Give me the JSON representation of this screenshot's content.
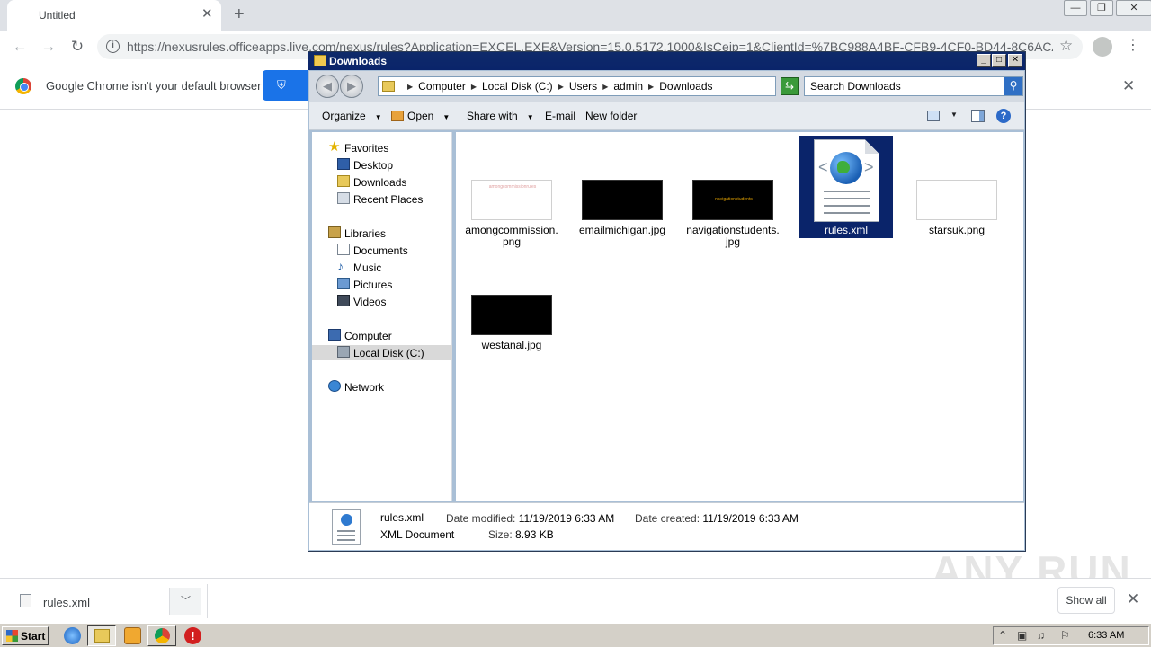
{
  "chrome": {
    "tab_title": "Untitled",
    "tab_close": "✕",
    "new_tab": "+",
    "url": "https://nexusrules.officeapps.live.com/nexus/rules?Application=EXCEL.EXE&Version=15.0.5172.1000&IsCeip=1&ClientId=%7BC988A4BF-CFB9-4CF0-BD44-8C6ACA...",
    "infobar_text": "Google Chrome isn't your default browser",
    "infobar_button_label": "S",
    "infobar_close": "✕"
  },
  "explorer": {
    "title": "Downloads",
    "breadcrumbs": [
      "Computer",
      "Local Disk (C:)",
      "Users",
      "admin",
      "Downloads"
    ],
    "search_placeholder": "Search Downloads",
    "commands": {
      "organize": "Organize",
      "open": "Open",
      "share_with": "Share with",
      "email": "E-mail",
      "new_folder": "New folder"
    },
    "nav": {
      "favorites": "Favorites",
      "desktop": "Desktop",
      "downloads": "Downloads",
      "recent_places": "Recent Places",
      "libraries": "Libraries",
      "documents": "Documents",
      "music": "Music",
      "pictures": "Pictures",
      "videos": "Videos",
      "computer": "Computer",
      "local_disk": "Local Disk (C:)",
      "network": "Network"
    },
    "files": [
      {
        "name": "amongcommission.png",
        "thumb": "white",
        "caption": "amongcommissionrules"
      },
      {
        "name": "emailmichigan.jpg",
        "thumb": "black",
        "caption": ""
      },
      {
        "name": "navigationstudents.jpg",
        "thumb": "black",
        "caption": "navigationstudents"
      },
      {
        "name": "rules.xml",
        "thumb": "xml",
        "caption": ""
      },
      {
        "name": "starsuk.png",
        "thumb": "white",
        "caption": ""
      },
      {
        "name": "westanal.jpg",
        "thumb": "black",
        "caption": ""
      }
    ],
    "details": {
      "name": "rules.xml",
      "type": "XML Document",
      "modified_label": "Date modified:",
      "modified_value": "11/19/2019 6:33 AM",
      "created_label": "Date created:",
      "created_value": "11/19/2019 6:33 AM",
      "size_label": "Size:",
      "size_value": "8.93 KB"
    }
  },
  "download_bar": {
    "file_name": "rules.xml",
    "show_all": "Show all",
    "close": "✕"
  },
  "watermark": "ANY RUN",
  "taskbar": {
    "start_label": "Start",
    "clock": "6:33 AM"
  }
}
